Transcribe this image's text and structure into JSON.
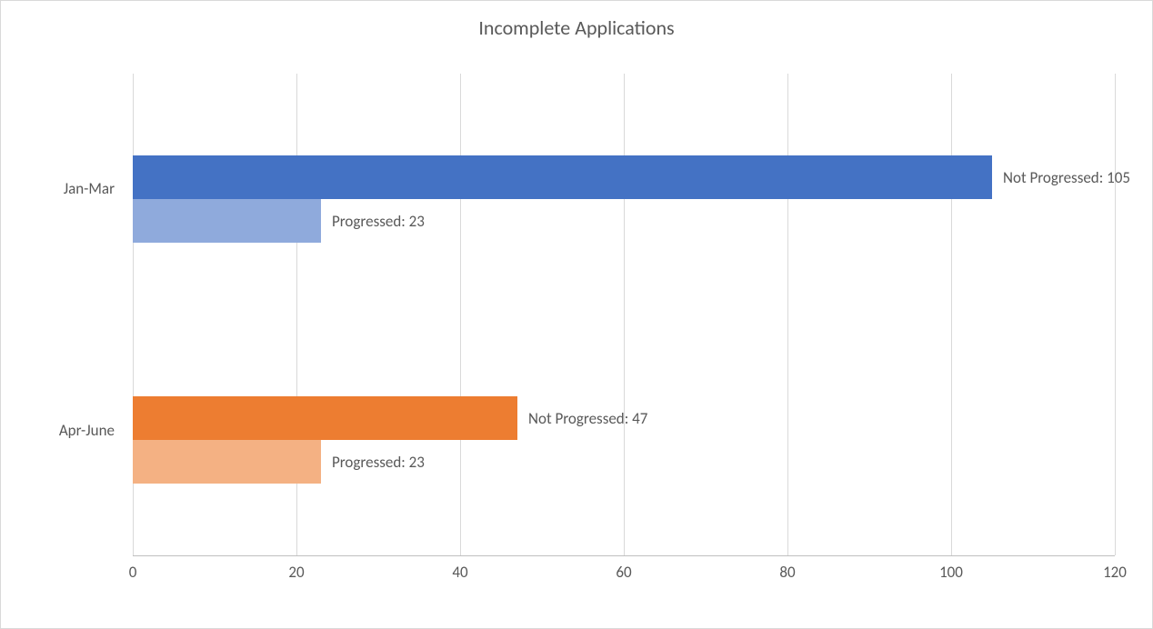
{
  "chart_data": {
    "type": "bar",
    "orientation": "horizontal",
    "title": "Incomplete Applications",
    "categories": [
      "Jan-Mar",
      "Apr-June"
    ],
    "series": [
      {
        "name": "Not Progressed",
        "values": [
          105,
          47
        ]
      },
      {
        "name": "Progressed",
        "values": [
          23,
          23
        ]
      }
    ],
    "x_ticks": [
      0,
      20,
      40,
      60,
      80,
      100,
      120
    ],
    "xlim": [
      0,
      120
    ],
    "colors": {
      "jan_mar_not_progressed": "#4472C4",
      "jan_mar_progressed": "#8FAADC",
      "apr_june_not_progressed": "#ED7D31",
      "apr_june_progressed": "#F4B183"
    },
    "data_labels": {
      "jan_mar_not_progressed": "Not Progressed: 105",
      "jan_mar_progressed": "Progressed: 23",
      "apr_june_not_progressed": "Not Progressed: 47",
      "apr_june_progressed": "Progressed: 23"
    }
  }
}
